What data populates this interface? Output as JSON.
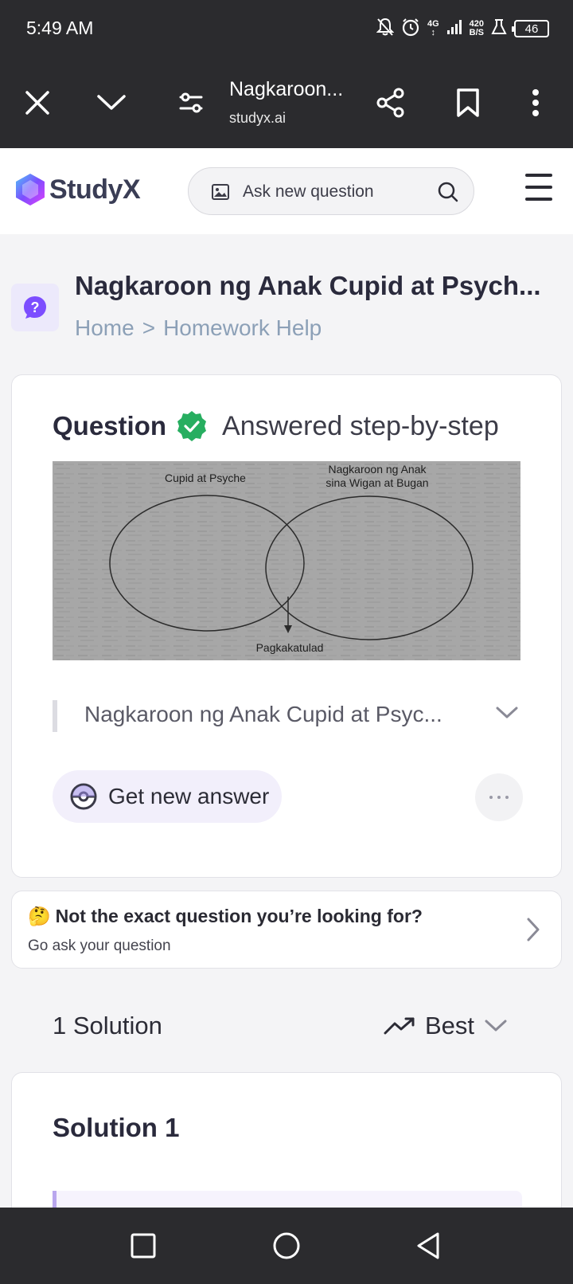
{
  "status_bar": {
    "time": "5:49 AM",
    "network_top": "4G",
    "speed_value": "420",
    "speed_unit": "B/S",
    "battery": "46"
  },
  "browser": {
    "title": "Nagkaroon...",
    "url": "studyx.ai"
  },
  "header": {
    "logo_text": "StudyX",
    "search_placeholder": "Ask new question"
  },
  "page": {
    "title": "Nagkaroon ng Anak Cupid at Psych...",
    "breadcrumb": [
      "Home",
      ">",
      "Homework Help"
    ]
  },
  "question": {
    "label": "Question",
    "status": "Answered step-by-step",
    "image_labels": {
      "left": "Cupid at Psyche",
      "right_line1": "Nagkaroon ng Anak",
      "right_line2": "sina Wigan at Bugan",
      "bottom": "Pagkakatulad"
    },
    "text_preview": "Nagkaroon ng Anak Cupid at Psyc...",
    "new_answer_label": "Get new answer"
  },
  "not_exact": {
    "emoji": "🤔",
    "title": "Not the exact question you’re looking for?",
    "subtitle": "Go ask your question"
  },
  "solutions": {
    "count_label": "1 Solution",
    "sort_label": "Best",
    "items": [
      {
        "title": "Solution 1"
      }
    ]
  },
  "colors": {
    "verified_green": "#27ae60",
    "brand_purple": "#7c4dff",
    "breadcrumb_blue": "#8ca0b7"
  }
}
